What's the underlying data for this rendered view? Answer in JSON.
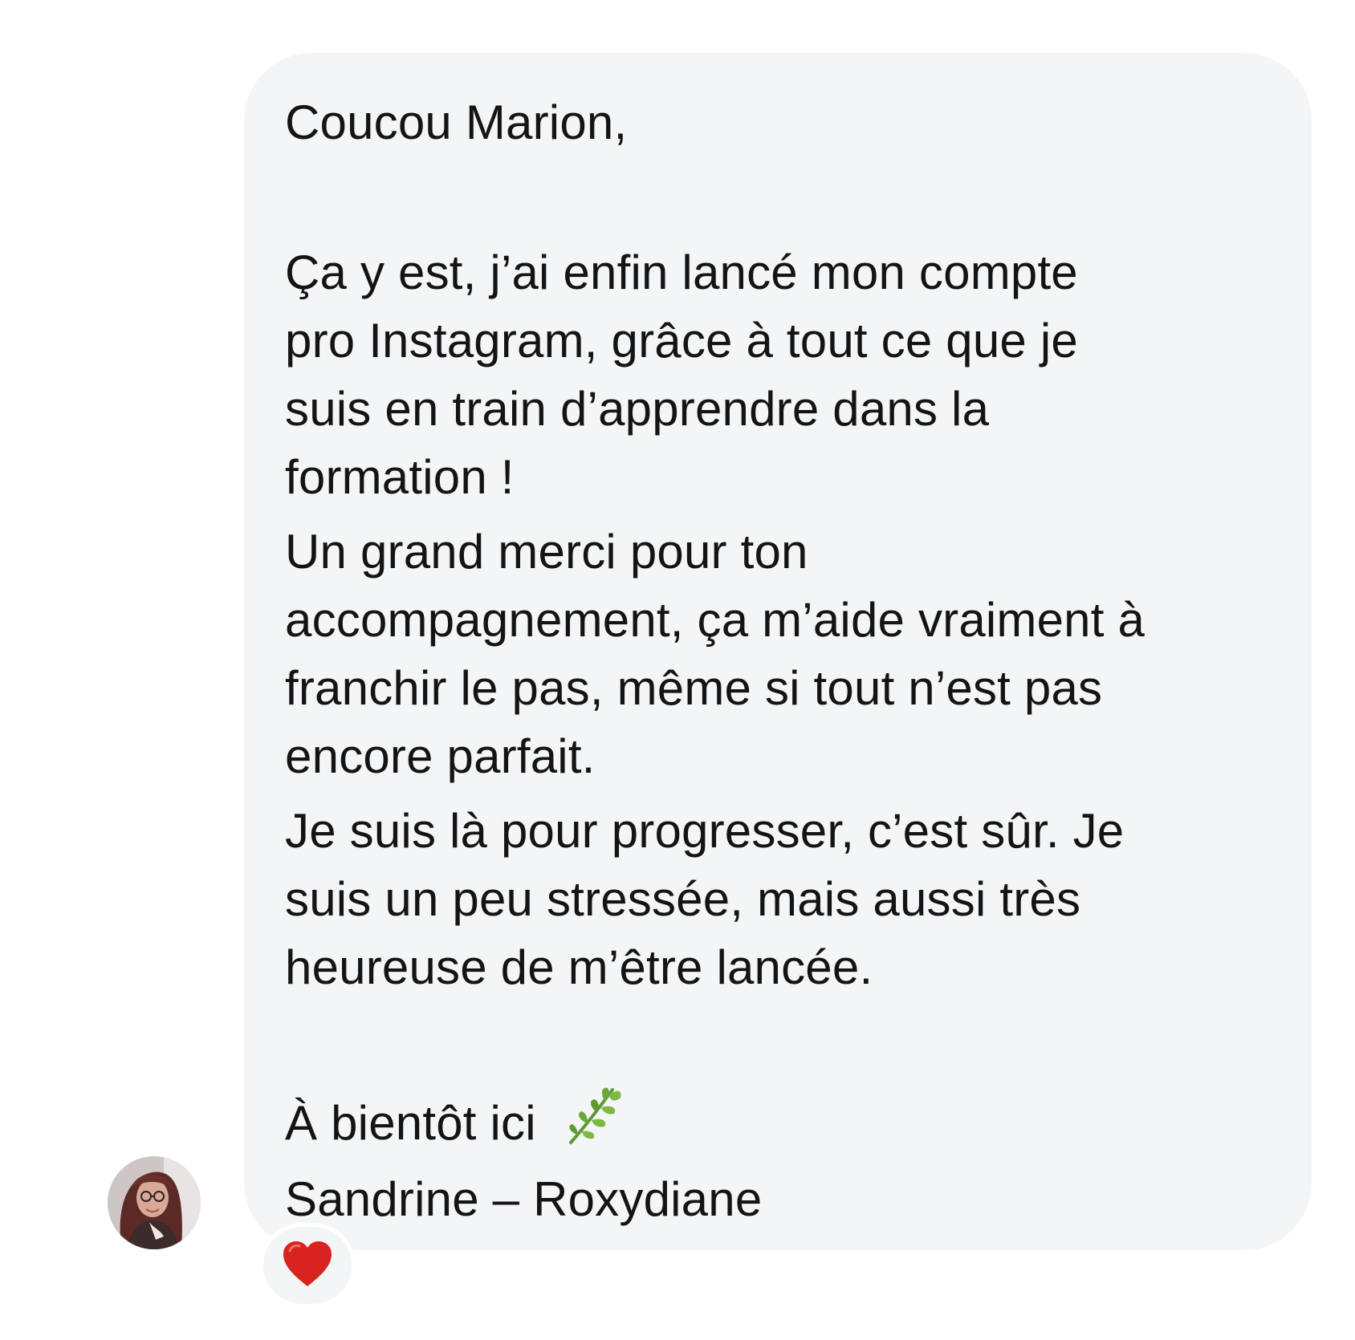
{
  "message": {
    "greeting": "Coucou Marion,",
    "paragraph1": [
      "Ça y est, j’ai enfin lancé mon compte",
      "pro Instagram, grâce à tout ce que je",
      "suis en train d’apprendre dans la",
      "formation !"
    ],
    "paragraph2": [
      "Un grand merci pour ton",
      "accompagnement, ça m’aide vraiment à",
      "franchir le pas, même si tout n’est pas",
      "encore parfait."
    ],
    "paragraph3": [
      "Je suis là pour progresser, c’est sûr. Je",
      "suis un peu stressée, mais aussi très",
      "heureuse de m’être lancée."
    ],
    "closing": "À bientôt ici",
    "closing_emoji": "herb-icon",
    "signature": "Sandrine – Roxydiane"
  },
  "sender": {
    "avatar": "avatar-photo"
  },
  "reaction": {
    "emoji": "red-heart-icon",
    "color": "#d8231f"
  },
  "colors": {
    "bubble": "#f4f5f7",
    "text": "#141414",
    "leaf": "#6aa83a"
  }
}
